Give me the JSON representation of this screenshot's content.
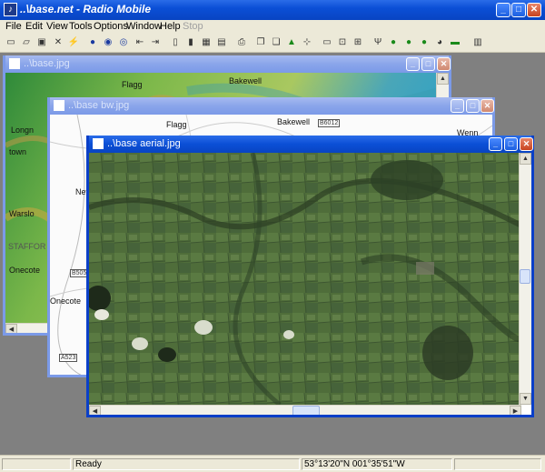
{
  "app": {
    "title": "..\\base.net - Radio Mobile",
    "icon_glyph": "♪"
  },
  "menu": {
    "items": [
      {
        "label": "File",
        "enabled": true
      },
      {
        "label": "Edit",
        "enabled": true
      },
      {
        "label": "View",
        "enabled": true
      },
      {
        "label": "Tools",
        "enabled": true
      },
      {
        "label": "Options",
        "enabled": true
      },
      {
        "label": "Window",
        "enabled": true
      },
      {
        "label": "Help",
        "enabled": true
      },
      {
        "label": "Stop",
        "enabled": false
      }
    ]
  },
  "toolbar": {
    "icons": [
      "new-icon",
      "open-icon",
      "save-icon",
      "network-properties-icon",
      "units-icon",
      "world-icon",
      "map-properties-icon",
      "merge-icon",
      "center-left-icon",
      "center-right-icon",
      "copy-icon",
      "paste-icon",
      "picture-icon",
      "save-picture-icon",
      "print-icon",
      "copy-map-icon",
      "paste-map-icon",
      "elevation-grid-icon",
      "select-icon",
      "window-icon",
      "zoom-icon",
      "fit-icon",
      "antenna-icon",
      "radio-link-icon",
      "coverage-icon",
      "coverage-polar-icon",
      "3d-view-icon",
      "histogram-icon",
      "traffic-icon"
    ]
  },
  "windows": {
    "base": {
      "title": "..\\base.jpg"
    },
    "bw": {
      "title": "..\\base bw.jpg"
    },
    "aerial": {
      "title": "..\\base aerial.jpg"
    }
  },
  "map_labels": {
    "flagg": "Flagg",
    "bakewell": "Bakewell",
    "longnor": "Longn",
    "town": "town",
    "warslow": "Warslo",
    "onecote": "Onecote",
    "stafford": "STAFFOR",
    "newhaven": "Nev",
    "road_b6012": "B6012",
    "road_b5053": "B505",
    "road_a523": "A523",
    "winster": "Wenn"
  },
  "status": {
    "left": "",
    "state": "Ready",
    "coords": "53°13'20\"N 001°35'51\"W",
    "extra": ""
  },
  "colors": {
    "xp_blue": "#0a3fc8",
    "mdi_bg": "#808080"
  }
}
